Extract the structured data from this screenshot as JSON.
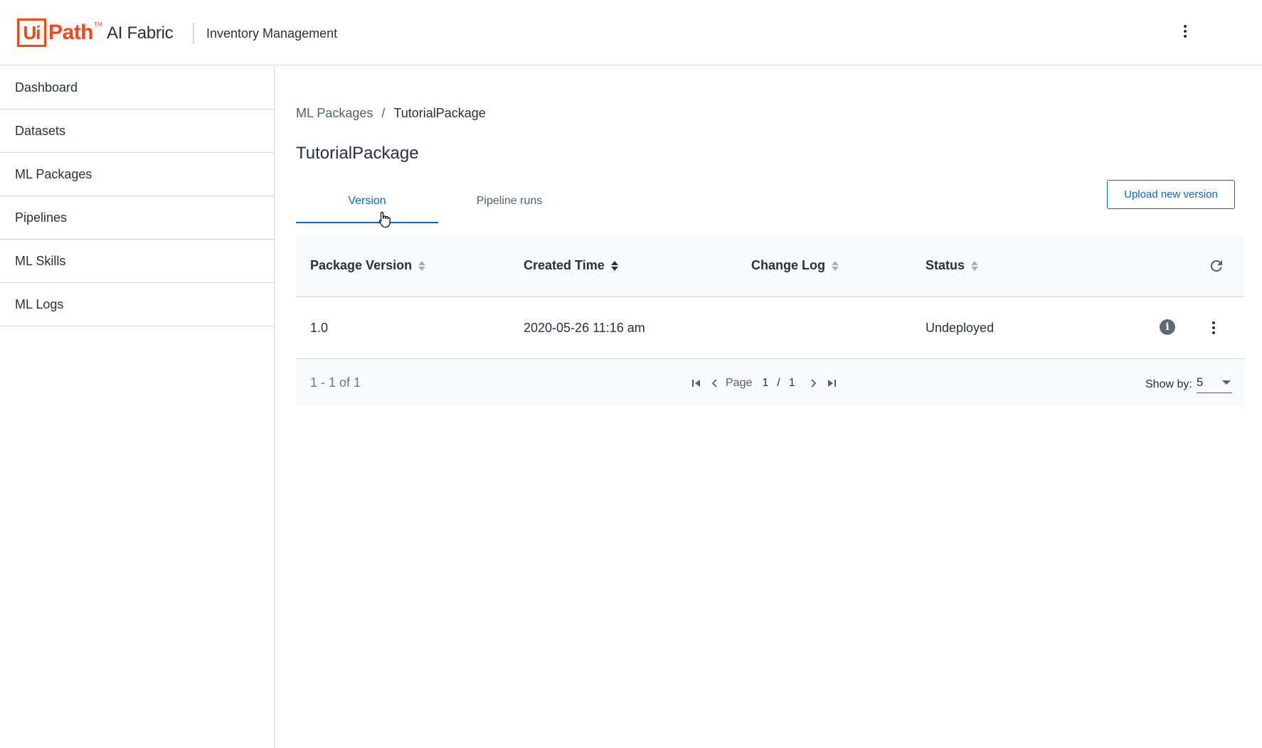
{
  "header": {
    "logo_ui": "Ui",
    "logo_path": "Path",
    "logo_tm": "TM",
    "product": "AI Fabric",
    "title": "Inventory Management"
  },
  "sidebar": {
    "items": [
      {
        "label": "Dashboard"
      },
      {
        "label": "Datasets"
      },
      {
        "label": "ML Packages"
      },
      {
        "label": "Pipelines"
      },
      {
        "label": "ML Skills"
      },
      {
        "label": "ML Logs"
      }
    ]
  },
  "breadcrumb": {
    "parent": "ML Packages",
    "separator": "/",
    "current": "TutorialPackage"
  },
  "page": {
    "title": "TutorialPackage",
    "tabs": [
      {
        "label": "Version",
        "active": true
      },
      {
        "label": "Pipeline runs",
        "active": false
      }
    ],
    "upload_label": "Upload new version"
  },
  "table": {
    "columns": [
      "Package Version",
      "Created Time",
      "Change Log",
      "Status"
    ],
    "rows": [
      {
        "version": "1.0",
        "created": "2020-05-26 11:16 am",
        "change_log": "",
        "status": "Undeployed"
      }
    ],
    "footer": {
      "range": "1 - 1 of 1",
      "page_label": "Page",
      "page_current": "1",
      "page_sep": "/",
      "page_total": "1",
      "show_by_label": "Show by:",
      "show_by_value": "5"
    }
  },
  "colors": {
    "brand": "#fa4616",
    "accent": "#0067df",
    "text": "#273139"
  },
  "icons": [
    "more-vertical-icon",
    "sort-icon",
    "refresh-icon",
    "info-icon",
    "first-page-icon",
    "prev-page-icon",
    "next-page-icon",
    "last-page-icon",
    "chevron-down-icon",
    "hand-cursor-icon"
  ]
}
